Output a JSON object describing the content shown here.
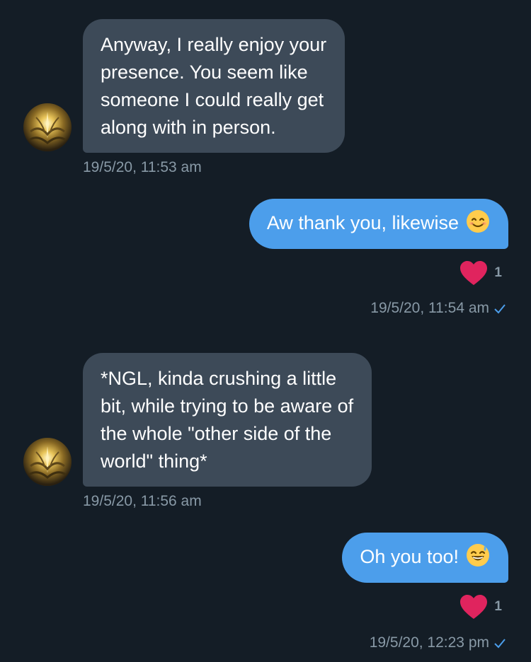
{
  "messages": [
    {
      "direction": "received",
      "lines": [
        "Anyway, I really enjoy your",
        "presence. You seem like",
        "someone I could really get",
        "along with in person."
      ],
      "timestamp": "19/5/20, 11:53 am"
    },
    {
      "direction": "sent",
      "text": "Aw thank you, likewise",
      "emoji": "smiling-face-icon",
      "reaction": {
        "icon": "heart-icon",
        "count": "1"
      },
      "timestamp": "19/5/20, 11:54 am",
      "seen": true
    },
    {
      "direction": "received",
      "lines": [
        "*NGL, kinda crushing a little",
        "bit, while trying to be aware of",
        "the whole \"other side of the",
        "world\" thing*"
      ],
      "timestamp": "19/5/20, 11:56 am"
    },
    {
      "direction": "sent",
      "text": "Oh you too!",
      "emoji": "sweat-smile-icon",
      "reaction": {
        "icon": "heart-icon",
        "count": "1"
      },
      "timestamp": "19/5/20, 12:23 pm",
      "seen": true
    }
  ],
  "colors": {
    "background": "#141d26",
    "received_bubble": "#3d4a58",
    "sent_bubble": "#4c9eeb",
    "timestamp": "#8899a6",
    "heart": "#e0245e",
    "check": "#4c9eeb"
  }
}
